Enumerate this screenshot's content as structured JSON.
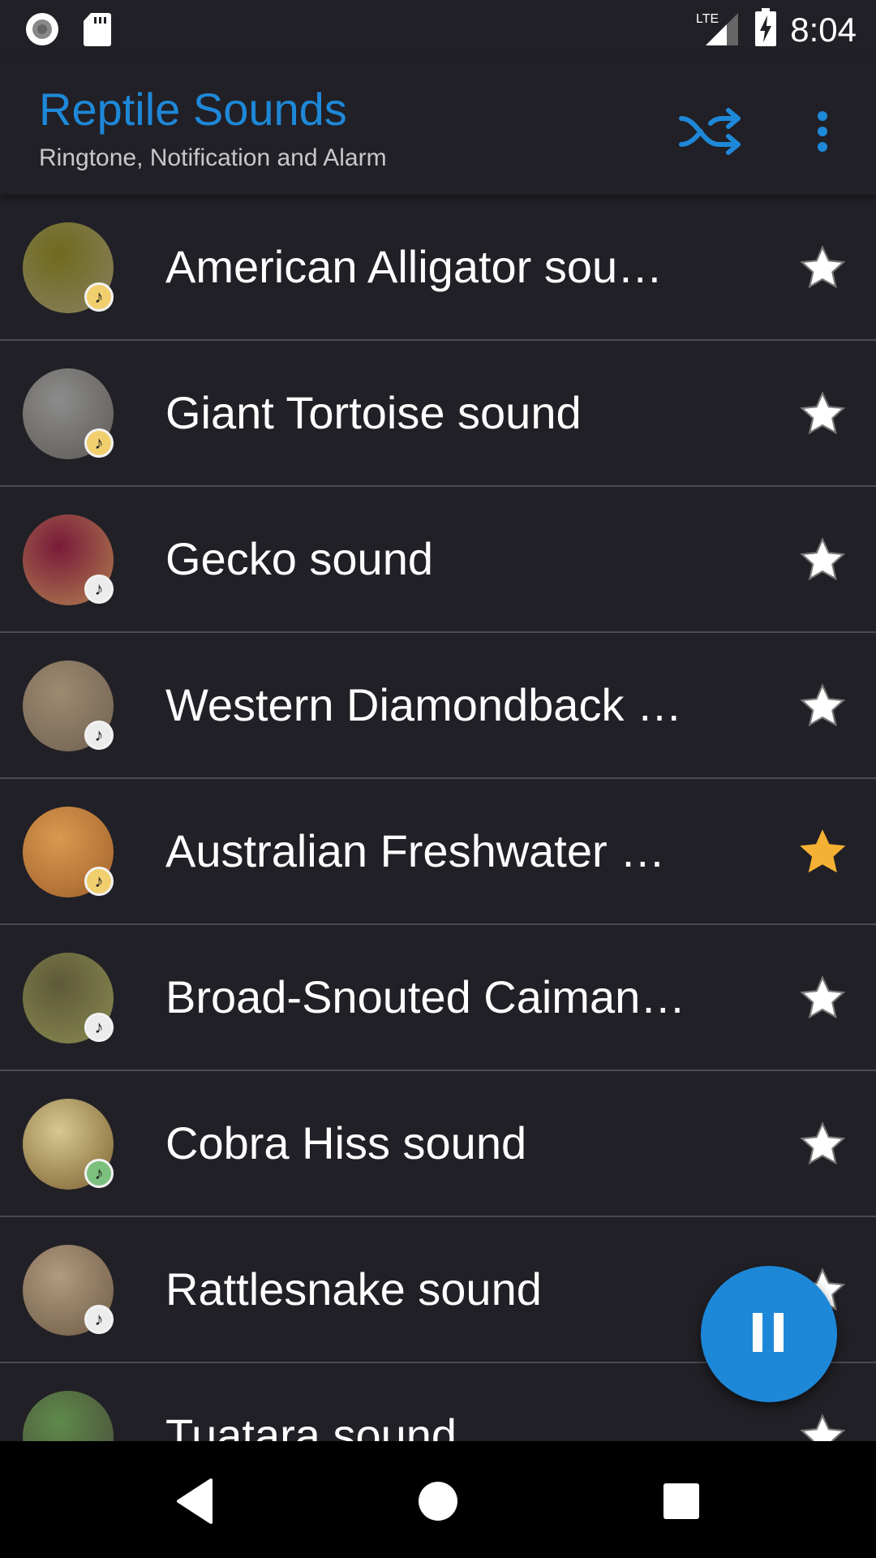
{
  "status_bar": {
    "time": "8:04",
    "network": "LTE",
    "icons": [
      "record-icon",
      "sd-card-icon",
      "lte-signal-icon",
      "battery-charging-icon"
    ]
  },
  "app_bar": {
    "title": "Reptile Sounds",
    "subtitle": "Ringtone, Notification and Alarm",
    "actions": [
      {
        "name": "shuffle",
        "icon": "shuffle-icon"
      },
      {
        "name": "more-options",
        "icon": "more-vert-icon"
      }
    ],
    "accent_color": "#1e88d8"
  },
  "sounds": [
    {
      "title": "American Alligator sou…",
      "badge_color": "#f2cf6e",
      "favorite": false,
      "thumb": [
        "#6f6a1e",
        "#8a8060"
      ]
    },
    {
      "title": "Giant Tortoise sound",
      "badge_color": "#f2cf6e",
      "favorite": false,
      "thumb": [
        "#8c8c8c",
        "#5e5a54"
      ]
    },
    {
      "title": "Gecko sound",
      "badge_color": "#ececec",
      "favorite": false,
      "thumb": [
        "#7a1a3a",
        "#b08050"
      ]
    },
    {
      "title": "Western Diamondback …",
      "badge_color": "#ececec",
      "favorite": false,
      "thumb": [
        "#9e8a70",
        "#6e6050"
      ]
    },
    {
      "title": "Australian Freshwater …",
      "badge_color": "#f2cf6e",
      "favorite": true,
      "thumb": [
        "#d89a50",
        "#a0602a"
      ]
    },
    {
      "title": "Broad-Snouted Caiman…",
      "badge_color": "#ececec",
      "favorite": false,
      "thumb": [
        "#5e5a3a",
        "#8a8a50"
      ]
    },
    {
      "title": "Cobra Hiss sound",
      "badge_color": "#7cc07e",
      "favorite": false,
      "thumb": [
        "#d8c890",
        "#7a6030"
      ]
    },
    {
      "title": "Rattlesnake sound",
      "badge_color": "#ececec",
      "favorite": false,
      "thumb": [
        "#b09a80",
        "#6e5a44"
      ]
    },
    {
      "title": "Tuatara sound",
      "badge_color": "#ececec",
      "favorite": false,
      "thumb": [
        "#5e8a4a",
        "#4a4a3a"
      ]
    }
  ],
  "star_colors": {
    "on": "#f5b133",
    "off": "#ffffff"
  },
  "fab": {
    "icon": "pause-icon",
    "color": "#1e88d8"
  },
  "nav_bar": {
    "buttons": [
      "back",
      "home",
      "recents"
    ]
  }
}
